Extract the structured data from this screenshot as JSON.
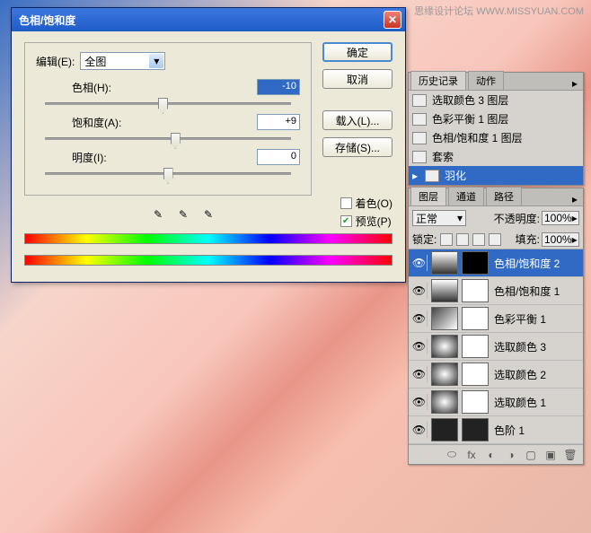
{
  "watermark": "思缘设计论坛  WWW.MISSYUAN.COM",
  "dialog": {
    "title": "色相/饱和度",
    "edit_label": "编辑(E):",
    "edit_value": "全图",
    "hue_label": "色相(H):",
    "hue_value": "-10",
    "sat_label": "饱和度(A):",
    "sat_value": "+9",
    "light_label": "明度(I):",
    "light_value": "0",
    "ok": "确定",
    "cancel": "取消",
    "load": "载入(L)...",
    "save": "存储(S)...",
    "colorize": "着色(O)",
    "preview": "预览(P)"
  },
  "history": {
    "tab1": "历史记录",
    "tab2": "动作",
    "items": [
      "选取颜色 3 图层",
      "色彩平衡 1 图层",
      "色相/饱和度 1 图层",
      "套索",
      "羽化"
    ]
  },
  "layers": {
    "tab1": "图层",
    "tab2": "通道",
    "tab3": "路径",
    "mode": "正常",
    "opacity_label": "不透明度:",
    "opacity_value": "100%",
    "lock_label": "锁定:",
    "fill_label": "填充:",
    "fill_value": "100%",
    "items": [
      "色相/饱和度 2",
      "色相/饱和度 1",
      "色彩平衡 1",
      "选取颜色 3",
      "选取颜色 2",
      "选取颜色 1",
      "色阶 1"
    ]
  }
}
